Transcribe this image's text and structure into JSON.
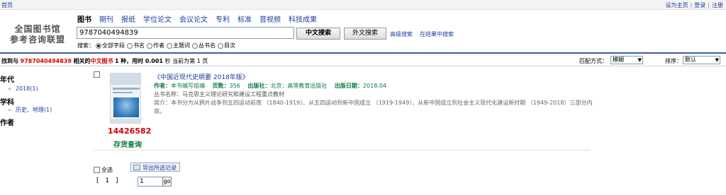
{
  "topbar": {
    "home": "首页",
    "links": [
      "设为主页",
      "登录",
      "注册"
    ]
  },
  "logo": {
    "line1": "全国图书馆",
    "line2": "参考咨询联盟"
  },
  "tabs": [
    "图书",
    "期刊",
    "报纸",
    "学位论文",
    "会议论文",
    "专利",
    "标准",
    "音视频",
    "科技成果"
  ],
  "search": {
    "value": "9787040494839",
    "cn_button": "中文搜索",
    "en_button": "外文搜索",
    "advanced": "高级搜索",
    "in_results": "在结果中搜索",
    "by_label": "搜索：",
    "options": [
      "全部字段",
      "书名",
      "作者",
      "主题词",
      "丛书名",
      "目次"
    ],
    "selected_option": "全部字段"
  },
  "summary": {
    "p1": "找到与",
    "query": "9787040494839",
    "p2": "相关的",
    "type": "中文图书",
    "count": "1",
    "p3": "种，用时",
    "time": "0.001",
    "p4": "秒 当前为第 1 页",
    "match_label": "匹配方式：",
    "match_value": "模糊",
    "sort_label": "排序：",
    "sort_value": "默认"
  },
  "facets": {
    "year_title": "年代",
    "year_item": "2018(1)",
    "subject_title": "学科",
    "subject_item": "历史、地理(1)",
    "author_title": "作者"
  },
  "record": {
    "title": "《中国近现代史纲要 2018年版》",
    "author_label": "作者：",
    "author": "本书编写组编",
    "pages_label": "页数：",
    "pages": "356",
    "publisher_label": "出版社：",
    "publisher": "北京：高等教育出版社",
    "date_label": "出版日期：",
    "date": "2018.04",
    "series": "丛书名称：马克思主义理论研究和建设工程重点教材",
    "abstract": "简介：本书分为从鸦片战争到五四运动前夜 （1840-1919）、从五四运动到新中国成立 （1919-1949）、从新中国成立到社会主义现代化建设新时期 （1949-2018）三部分内容。",
    "ss_number": "14426582",
    "stock_check": "存货查询"
  },
  "footer": {
    "select_all": "全选",
    "export": "导出所选记录",
    "pager": "[ 1 ]",
    "page_value": "1",
    "go": "go"
  },
  "colors": {
    "link": "#1a3e9c",
    "red": "#d00000",
    "green": "#0a7a3c",
    "rule": "#3d5c9e"
  }
}
